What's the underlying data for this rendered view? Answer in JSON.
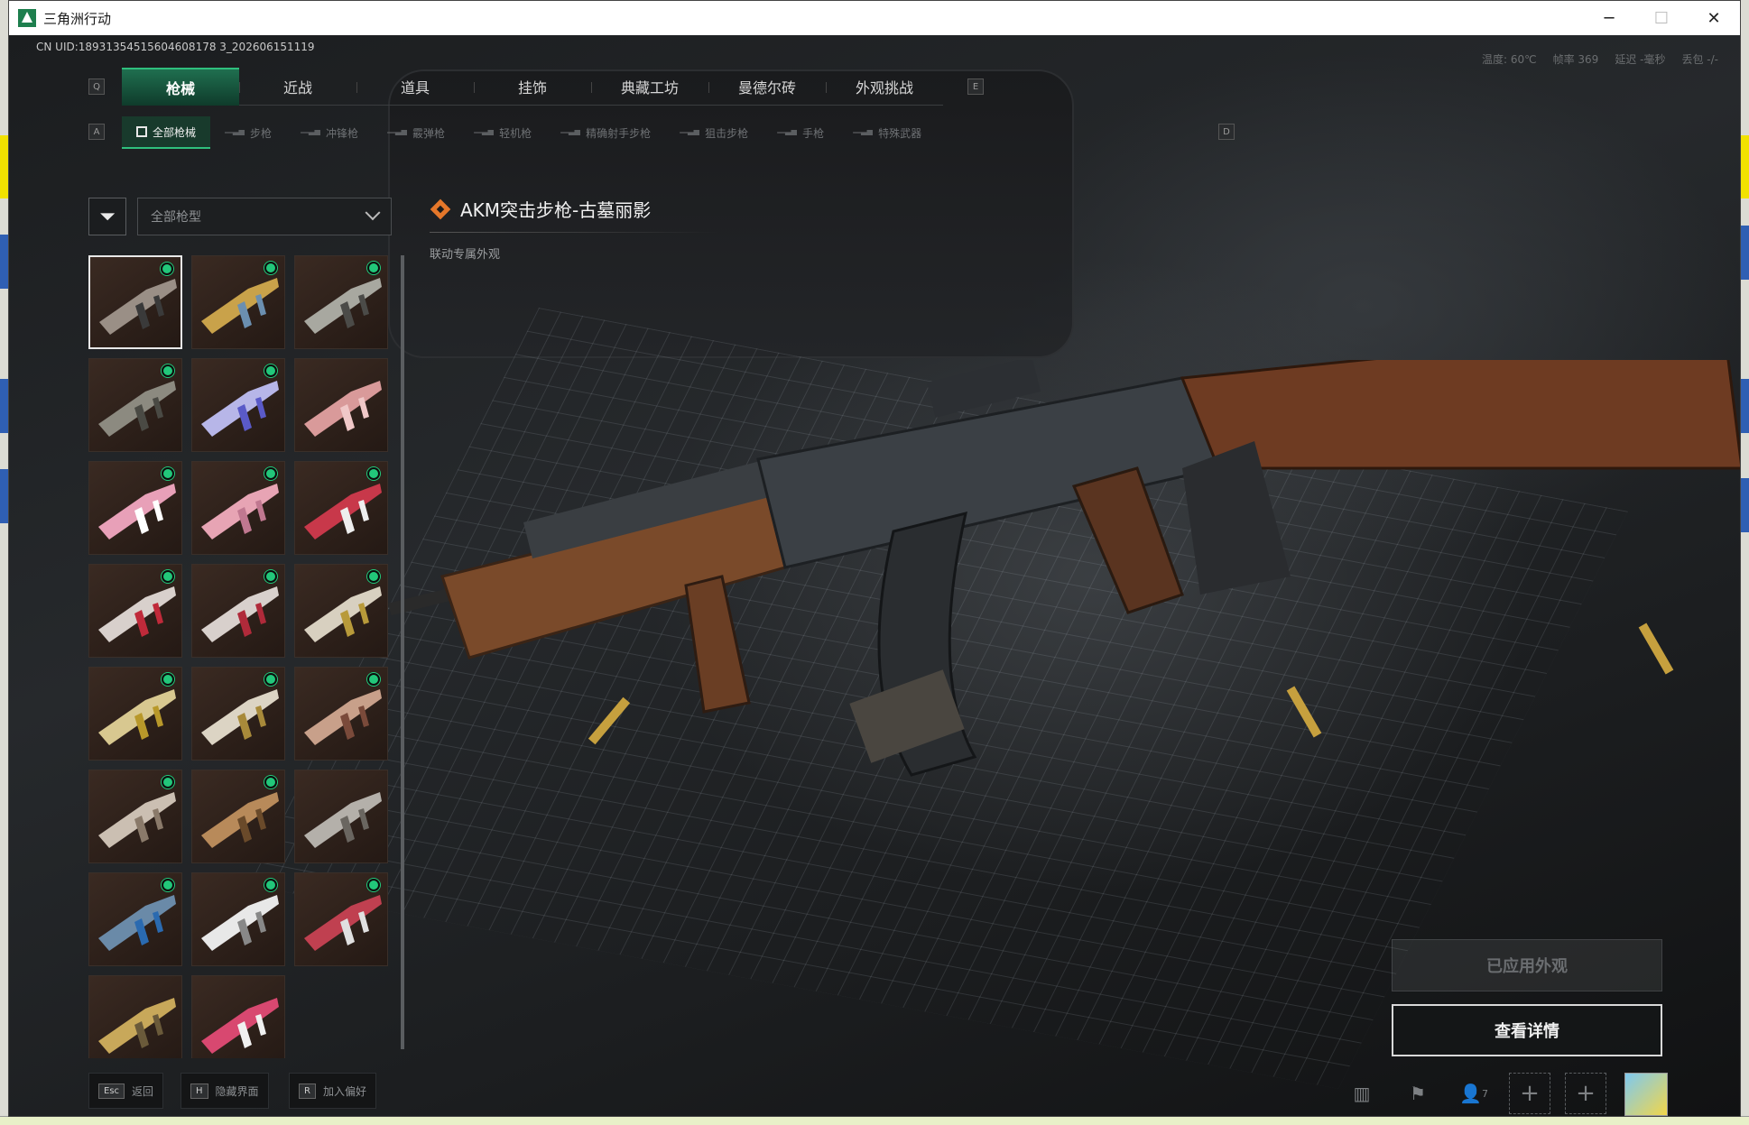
{
  "window": {
    "title": "三角洲行动",
    "controls": [
      "─",
      "☐",
      "✕"
    ]
  },
  "uid": "CN UID:18931354515604608178 3_202606151119",
  "stats": {
    "temp": "温度: 60℃",
    "fps": "帧率 369",
    "latency": "延迟 -毫秒",
    "loss": "丢包 -/-"
  },
  "tabs": {
    "left_key": "Q",
    "right_key": "E",
    "items": [
      {
        "label": "枪械",
        "active": true
      },
      {
        "label": "近战",
        "active": false
      },
      {
        "label": "道具",
        "active": false
      },
      {
        "label": "挂饰",
        "active": false
      },
      {
        "label": "典藏工坊",
        "active": false
      },
      {
        "label": "曼德尔砖",
        "active": false
      },
      {
        "label": "外观挑战",
        "active": false
      }
    ]
  },
  "subtabs": {
    "left_key": "A",
    "right_key": "D",
    "items": [
      {
        "label": "全部枪械",
        "active": true
      },
      {
        "label": "步枪",
        "active": false
      },
      {
        "label": "冲锋枪",
        "active": false
      },
      {
        "label": "霰弹枪",
        "active": false
      },
      {
        "label": "轻机枪",
        "active": false
      },
      {
        "label": "精确射手步枪",
        "active": false
      },
      {
        "label": "狙击步枪",
        "active": false
      },
      {
        "label": "手枪",
        "active": false
      },
      {
        "label": "特殊武器",
        "active": false
      }
    ]
  },
  "filter": {
    "icon": "filter-icon",
    "dropdown_value": "全部枪型"
  },
  "weapon": {
    "name": "AKM突击步枪-古墓丽影",
    "subtitle": "联动专属外观"
  },
  "actions": {
    "applied": "已应用外观",
    "detail": "查看详情"
  },
  "hints": [
    {
      "key": "Esc",
      "label": "返回"
    },
    {
      "key": "H",
      "label": "隐藏界面"
    },
    {
      "key": "R",
      "label": "加入偏好"
    }
  ],
  "bottom_icons": {
    "stats_icon": "bar-chart-icon",
    "flag_icon": "flag-icon",
    "friends_count": "7"
  },
  "skins": [
    {
      "color": "#9a8f86",
      "accent": "#3a3a3a",
      "owned": true
    },
    {
      "color": "#c9a24a",
      "accent": "#6b8fb0",
      "owned": true
    },
    {
      "color": "#a8a8a0",
      "accent": "#4b4b48",
      "owned": true
    },
    {
      "color": "#8c8a80",
      "accent": "#4a4a44",
      "owned": true
    },
    {
      "color": "#b7b6e8",
      "accent": "#5a5ac8",
      "owned": true
    },
    {
      "color": "#d99a9a",
      "accent": "#f0c8c8",
      "owned": false
    },
    {
      "color": "#e8a0b8",
      "accent": "#ffffff",
      "owned": true
    },
    {
      "color": "#e7a4b4",
      "accent": "#c07890",
      "owned": true
    },
    {
      "color": "#c8384a",
      "accent": "#eeeeee",
      "owned": true
    },
    {
      "color": "#d8d0cc",
      "accent": "#c02a3a",
      "owned": true
    },
    {
      "color": "#d8d0cc",
      "accent": "#b02a3a",
      "owned": true
    },
    {
      "color": "#d8d0c0",
      "accent": "#b89a3a",
      "owned": true
    },
    {
      "color": "#d8c890",
      "accent": "#b8982a",
      "owned": true
    },
    {
      "color": "#dcd4c4",
      "accent": "#a88a3a",
      "owned": true
    },
    {
      "color": "#c8a08a",
      "accent": "#7a4a3a",
      "owned": true
    },
    {
      "color": "#cbbfb2",
      "accent": "#8a7a6a",
      "owned": true
    },
    {
      "color": "#b88a5a",
      "accent": "#6a4a2a",
      "owned": true
    },
    {
      "color": "#b4b0aa",
      "accent": "#6a6660",
      "owned": false
    },
    {
      "color": "#6a8aa8",
      "accent": "#2a6ab0",
      "owned": true
    },
    {
      "color": "#e8e8e8",
      "accent": "#888888",
      "owned": true
    },
    {
      "color": "#c04050",
      "accent": "#e0e0e0",
      "owned": true
    },
    {
      "color": "#c8a85a",
      "accent": "#6a5a3a",
      "owned": false
    },
    {
      "color": "#d84870",
      "accent": "#f0f0f0",
      "owned": false
    }
  ]
}
